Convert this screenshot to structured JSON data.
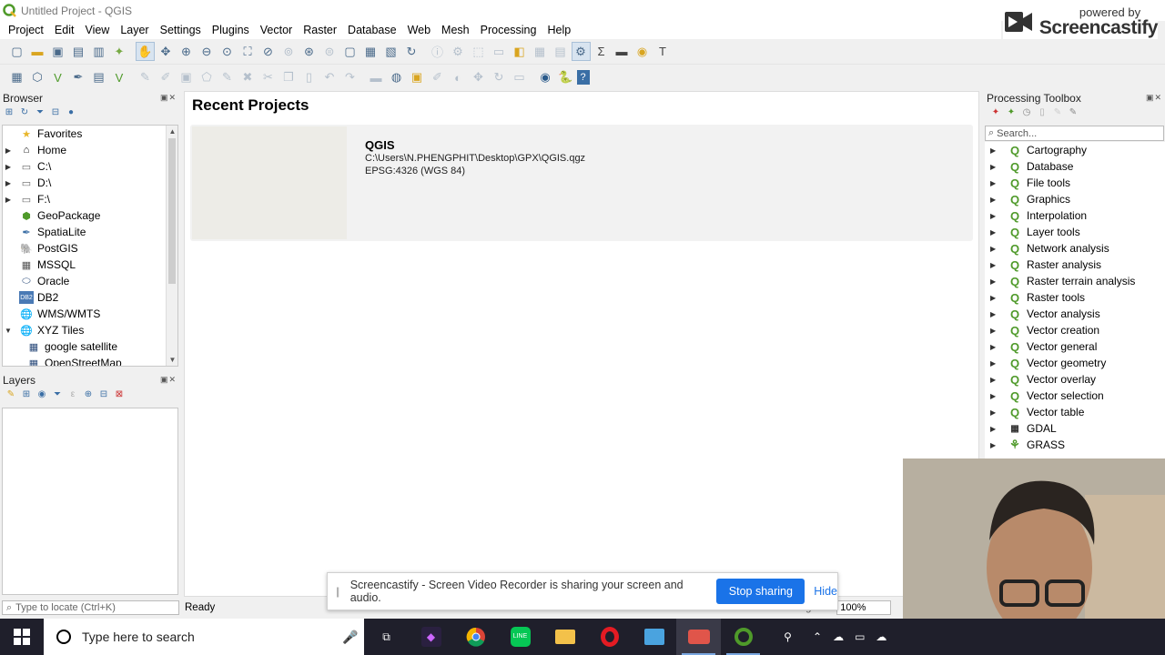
{
  "window": {
    "title": "Untitled Project - QGIS"
  },
  "brand": {
    "powered": "powered by",
    "name": "Screencastify"
  },
  "menu": [
    {
      "label": "Project"
    },
    {
      "label": "Edit"
    },
    {
      "label": "View"
    },
    {
      "label": "Layer"
    },
    {
      "label": "Settings"
    },
    {
      "label": "Plugins"
    },
    {
      "label": "Vector"
    },
    {
      "label": "Raster"
    },
    {
      "label": "Database"
    },
    {
      "label": "Web"
    },
    {
      "label": "Mesh"
    },
    {
      "label": "Processing"
    },
    {
      "label": "Help"
    }
  ],
  "browser": {
    "title": "Browser",
    "items": [
      {
        "label": "Favorites",
        "icon": "star-icon"
      },
      {
        "label": "Home",
        "icon": "home-icon"
      },
      {
        "label": "C:\\",
        "icon": "folder-icon"
      },
      {
        "label": "D:\\",
        "icon": "folder-icon"
      },
      {
        "label": "F:\\",
        "icon": "folder-icon"
      },
      {
        "label": "GeoPackage",
        "icon": "geopackage-icon"
      },
      {
        "label": "SpatiaLite",
        "icon": "spatialite-icon"
      },
      {
        "label": "PostGIS",
        "icon": "postgis-icon"
      },
      {
        "label": "MSSQL",
        "icon": "mssql-icon"
      },
      {
        "label": "Oracle",
        "icon": "oracle-icon"
      },
      {
        "label": "DB2",
        "icon": "db2-icon"
      },
      {
        "label": "WMS/WMTS",
        "icon": "globe-icon"
      },
      {
        "label": "XYZ Tiles",
        "icon": "globe-icon"
      },
      {
        "label": "google satellite",
        "icon": "tiles-icon"
      },
      {
        "label": "OpenStreetMap",
        "icon": "tiles-icon"
      }
    ]
  },
  "layers": {
    "title": "Layers"
  },
  "recent": {
    "title": "Recent Projects",
    "project": {
      "name": "QGIS",
      "path": "C:\\Users\\N.PHENGPHIT\\Desktop\\GPX\\QGIS.qgz",
      "crs": "EPSG:4326 (WGS 84)"
    }
  },
  "toolbox": {
    "title": "Processing Toolbox",
    "search_placeholder": "Search...",
    "items": [
      {
        "label": "Cartography"
      },
      {
        "label": "Database"
      },
      {
        "label": "File tools"
      },
      {
        "label": "Graphics"
      },
      {
        "label": "Interpolation"
      },
      {
        "label": "Layer tools"
      },
      {
        "label": "Network analysis"
      },
      {
        "label": "Raster analysis"
      },
      {
        "label": "Raster terrain analysis"
      },
      {
        "label": "Raster tools"
      },
      {
        "label": "Vector analysis"
      },
      {
        "label": "Vector creation"
      },
      {
        "label": "Vector general"
      },
      {
        "label": "Vector geometry"
      },
      {
        "label": "Vector overlay"
      },
      {
        "label": "Vector selection"
      },
      {
        "label": "Vector table"
      },
      {
        "label": "GDAL"
      },
      {
        "label": "GRASS"
      }
    ]
  },
  "status": {
    "locate_placeholder": "Type to locate (Ctrl+K)",
    "ready": "Ready",
    "magnifier_label": "Magnifier",
    "magnifier_value": "100%"
  },
  "sharing": {
    "message": "Screencastify - Screen Video Recorder is sharing your screen and audio.",
    "stop_label": "Stop sharing",
    "hide_label": "Hide"
  },
  "taskbar": {
    "search_text": "Type here to search"
  },
  "colors": {
    "accent": "#1a73e8",
    "qgis_green": "#4f9a2a",
    "taskbar": "#1f1f2b"
  }
}
